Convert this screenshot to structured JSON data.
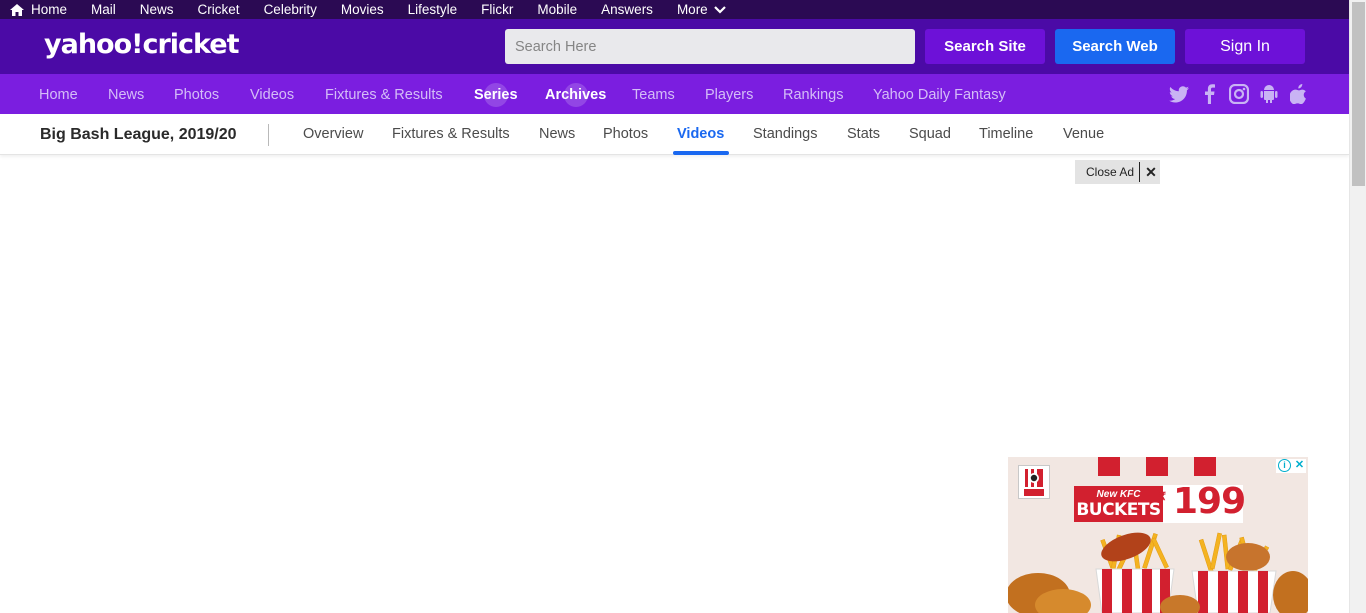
{
  "topbar": {
    "items": [
      "Home",
      "Mail",
      "News",
      "Cricket",
      "Celebrity",
      "Movies",
      "Lifestyle",
      "Flickr",
      "Mobile",
      "Answers",
      "More"
    ]
  },
  "brand": {
    "logo_text": "yahoo!cricket",
    "search_placeholder": "Search Here",
    "search_site_label": "Search Site",
    "search_web_label": "Search Web",
    "sign_in_label": "Sign In"
  },
  "main_nav": {
    "items": [
      "Home",
      "News",
      "Photos",
      "Videos",
      "Fixtures & Results",
      "Series",
      "Archives",
      "Teams",
      "Players",
      "Rankings",
      "Yahoo Daily Fantasy"
    ],
    "social_icons": [
      "twitter-icon",
      "facebook-icon",
      "instagram-icon",
      "android-icon",
      "apple-icon"
    ]
  },
  "sub_nav": {
    "series_title": "Big Bash League, 2019/20",
    "items": [
      "Overview",
      "Fixtures & Results",
      "News",
      "Photos",
      "Videos",
      "Standings",
      "Stats",
      "Squad",
      "Timeline",
      "Venue"
    ],
    "active": "Videos"
  },
  "close_ad": {
    "label": "Close Ad",
    "close_glyph": "✕"
  },
  "ad": {
    "brand_logo": "KFC",
    "badge_top": "New KFC",
    "badge_bottom": "BUCKETS",
    "currency": "₹",
    "price": "199"
  },
  "colors": {
    "topbar_bg": "#2b0a53",
    "brandbar_bg": "#4b0aa6",
    "mainnav_bg": "#7b1ee0",
    "accent_blue": "#1a68f0",
    "kfc_red": "#d2202f"
  }
}
